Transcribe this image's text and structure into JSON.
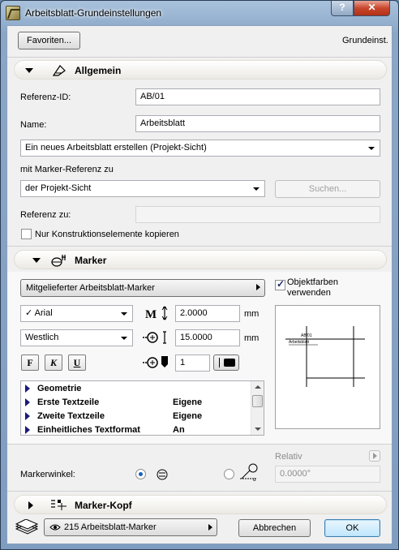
{
  "window": {
    "title": "Arbeitsblatt-Grundeinstellungen"
  },
  "titlebar": {
    "help": "?",
    "close": "✕"
  },
  "top": {
    "favorites": "Favoriten...",
    "defaults": "Grundeinst."
  },
  "general": {
    "title": "Allgemein",
    "ref_id_label": "Referenz-ID:",
    "ref_id_value": "AB/01",
    "name_label": "Name:",
    "name_value": "Arbeitsblatt",
    "creation_select": "Ein neues Arbeitsblatt erstellen (Projekt-Sicht)",
    "marker_ref_label": "mit Marker-Referenz zu",
    "marker_ref_select": "der Projekt-Sicht",
    "search_button": "Suchen...",
    "reference_to_label": "Referenz zu:",
    "reference_to_value": "",
    "copy_construction_label": "Nur Konstruktionselemente kopieren"
  },
  "marker": {
    "title": "Marker",
    "marker_type": "Mitgelieferter Arbeitsblatt-Marker",
    "object_colors_label_1": "Objektfarben",
    "object_colors_label_2": "verwenden",
    "font": "Arial",
    "font_check": "✓",
    "text_size": "2.0000",
    "text_size_unit": "mm",
    "anchor": "Westlich",
    "offset": "15.0000",
    "offset_unit": "mm",
    "bold": "F",
    "italic": "K",
    "underline": "U",
    "pen_number": "1",
    "list_rows": [
      {
        "name": "Geometrie",
        "value": ""
      },
      {
        "name": "Erste Textzeile",
        "value": "Eigene"
      },
      {
        "name": "Zweite Textzeile",
        "value": "Eigene"
      },
      {
        "name": "Einheitliches Textformat",
        "value": "An"
      }
    ],
    "preview_label_1": "AB/01",
    "preview_label_2": "Arbeitsblatt",
    "relative_label": "Relativ",
    "angle_label": "Markerwinkel:",
    "angle_value": "0.0000°"
  },
  "marker_head": {
    "title": "Marker-Kopf"
  },
  "footer": {
    "layer_select": "215 Arbeitsblatt-Marker",
    "cancel": "Abbrechen",
    "ok": "OK"
  }
}
